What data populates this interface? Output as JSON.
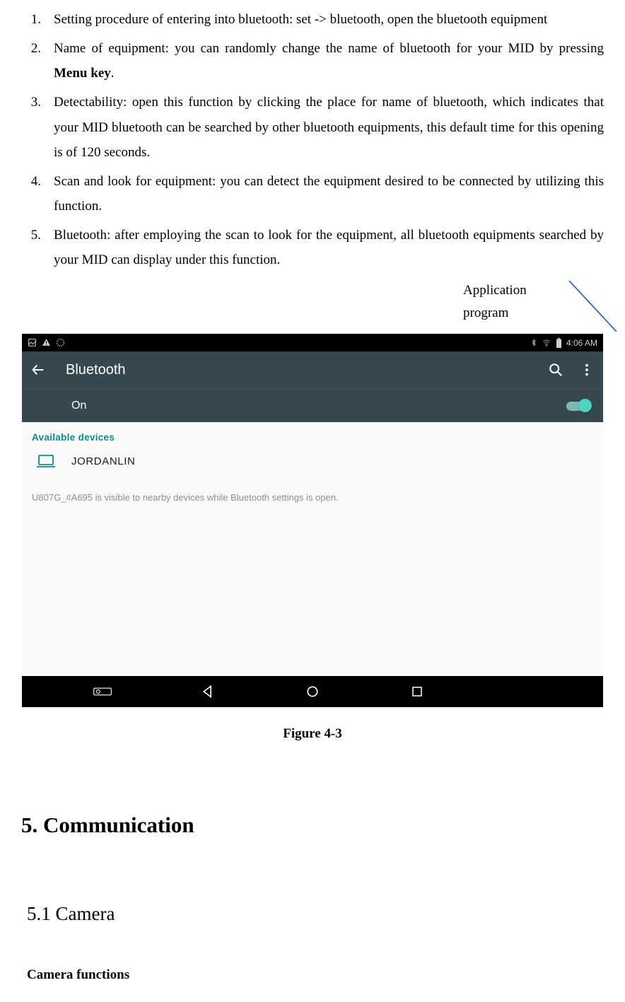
{
  "list": {
    "n1": "1.",
    "t1": "Setting procedure of entering into bluetooth: set -> bluetooth, open the bluetooth equipment",
    "n2": "2.",
    "t2a": "Name of equipment: you can randomly change the name of bluetooth for your MID by pressing ",
    "t2b": "Menu key",
    "t2c": ".",
    "n3": "3.",
    "t3": "Detectability: open this function by clicking the place for name of bluetooth, which indicates that your MID bluetooth can be searched by other bluetooth equipments, this default time for this opening is of 120 seconds.",
    "n4": "4.",
    "t4": "Scan and look for equipment: you can detect the equipment desired to be connected by utilizing this function.",
    "n5": "5.",
    "t5": "Bluetooth: after employing the scan to look for the equipment, all bluetooth equipments searched by your MID can display under this function."
  },
  "callout": {
    "line1": "Application",
    "line2": "program"
  },
  "mock": {
    "time": "4:06 AM",
    "toolbar_title": "Bluetooth",
    "on_label": "On",
    "available": "Available devices",
    "device": "JORDANLIN",
    "info": "U807G_#A695 is visible to nearby devices while Bluetooth settings is open."
  },
  "fig_caption": "Figure 4-3",
  "h_comm": "5. Communication",
  "h_cam": "5.1 Camera",
  "h_camfunc": "Camera functions"
}
